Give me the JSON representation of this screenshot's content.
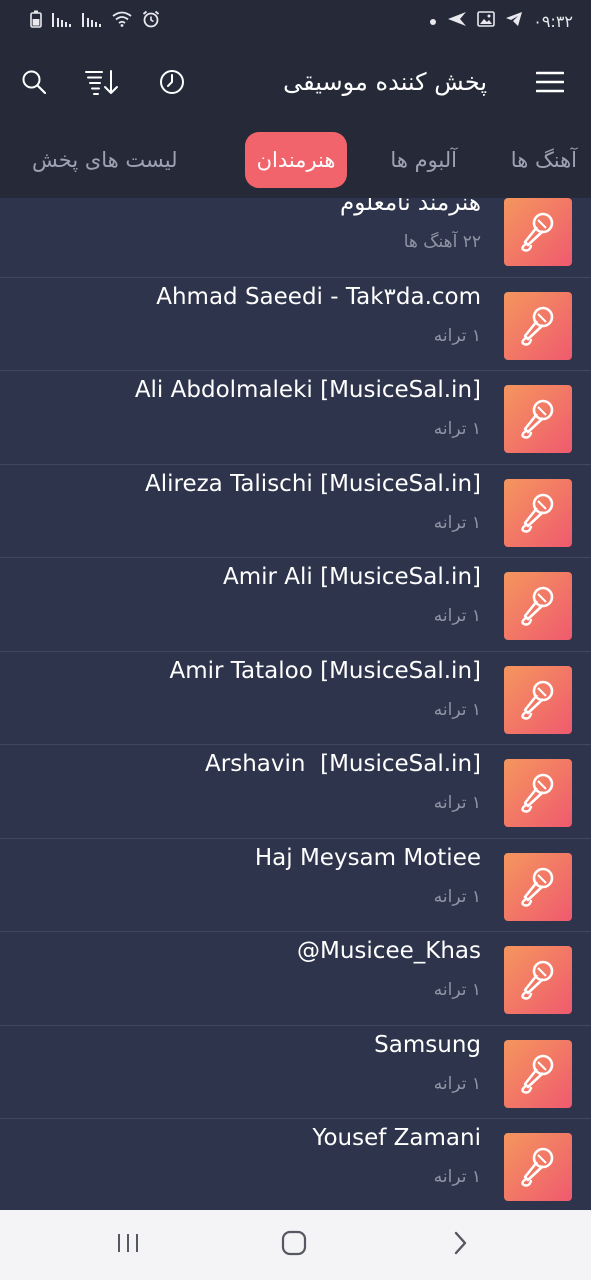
{
  "status_bar": {
    "time": "۰۹:۳۲",
    "icons": [
      "battery-icon",
      "signal-icon",
      "signal-icon",
      "wifi-icon",
      "alarm-icon",
      "dot-icon",
      "send-icon",
      "gallery-icon",
      "telegram-icon"
    ]
  },
  "app_bar": {
    "title": "پخش کننده موسیقی",
    "icons": [
      "search-icon",
      "sort-icon",
      "timer-icon",
      "menu-icon"
    ]
  },
  "tabs": [
    {
      "label": "آهنگ ها",
      "active": false
    },
    {
      "label": "آلبوم ها",
      "active": false
    },
    {
      "label": "هنرمندان",
      "active": true
    },
    {
      "label": "لیست های پخش",
      "active": false
    }
  ],
  "accent_color": "#f1646c",
  "artists": [
    {
      "name": "هنرمند نامعلوم",
      "count": "۲۲ آهنگ ها"
    },
    {
      "name": "Ahmad Saeedi - Tak۳da.com",
      "count": "۱ ترانه"
    },
    {
      "name": "Ali Abdolmaleki [MusiceSal.in]",
      "count": "۱ ترانه"
    },
    {
      "name": "Alireza Talischi [MusiceSal.in]",
      "count": "۱ ترانه"
    },
    {
      "name": "Amir Ali [MusiceSal.in]",
      "count": "۱ ترانه"
    },
    {
      "name": "Amir Tataloo [MusiceSal.in]",
      "count": "۱ ترانه"
    },
    {
      "name": "Arshavin  [MusiceSal.in]",
      "count": "۱ ترانه"
    },
    {
      "name": "Haj Meysam Motiee",
      "count": "۱ ترانه"
    },
    {
      "name": "@Musicee_Khas",
      "count": "۱ ترانه"
    },
    {
      "name": "Samsung",
      "count": "۱ ترانه"
    },
    {
      "name": "Yousef Zamani",
      "count": "۱ ترانه"
    }
  ],
  "nav_bar": {
    "icons": [
      "recent-apps-icon",
      "home-icon",
      "back-icon"
    ]
  }
}
